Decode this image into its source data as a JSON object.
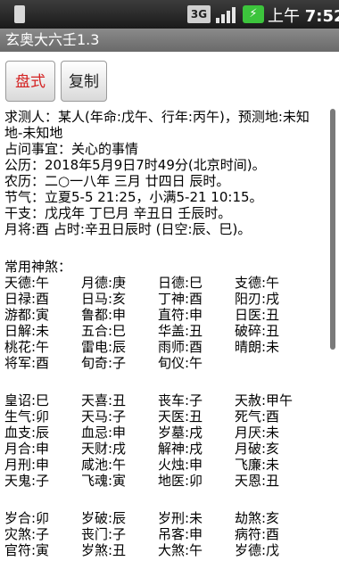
{
  "statusbar": {
    "time_prefix": "上午",
    "time": "7:52",
    "network": "3G",
    "battery_icon": "battery-charging-icon"
  },
  "app": {
    "title": "玄奥大六壬1.3"
  },
  "toolbar": {
    "pan_label": "盘式",
    "copy_label": "复制"
  },
  "info": {
    "line1": "求测人：某人(年命:戊午、行年:丙午)，预测地:未知",
    "line2": "地-未知地",
    "line3": "占问事宜：关心的事情",
    "line4": "公历：2018年5月9日7时49分(北京时间)。",
    "line5": "农历：二○一八年 三月 廿四日 辰时。",
    "line6": "节气：立夏5-5 21:25，小满5-21 10:15。",
    "line7": "干支：戊戌年  丁巳月  辛丑日  壬辰时。",
    "line8": "  月将:酉   占时:辛丑日辰时 (日空:辰、巳)。"
  },
  "gods": {
    "heading": "常用神煞：",
    "group1": [
      [
        "天德:午",
        "月德:庚",
        "日德:巳",
        "支德:午"
      ],
      [
        "日禄:酉",
        "日马:亥",
        "丁神:酉",
        "阳刃:戌"
      ],
      [
        "游都:寅",
        "鲁都:申",
        "直符:申",
        "日医:丑"
      ],
      [
        "日解:未",
        "五合:巳",
        "华盖:丑",
        "破碎:丑"
      ],
      [
        "桃花:午",
        "雷电:辰",
        "雨师:酉",
        "晴朗:未"
      ],
      [
        "将军:酉",
        "旬奇:子",
        "旬仪:午",
        ""
      ]
    ],
    "group2": [
      [
        "皇诏:巳",
        "天喜:丑",
        "丧车:子",
        "天赦:甲午"
      ],
      [
        "生气:卯",
        "天马:子",
        "天医:丑",
        "死气:酉"
      ],
      [
        "血支:辰",
        "血忌:申",
        "岁墓:戌",
        "月厌:未"
      ],
      [
        "月合:申",
        "天财:戌",
        "解神:戌",
        "月破:亥"
      ],
      [
        "月刑:申",
        "咸池:午",
        "火烛:申",
        "飞廉:未"
      ],
      [
        "天鬼:子",
        "飞魂:寅",
        "地医:卯",
        "天恩:丑"
      ]
    ],
    "group3": [
      [
        "岁合:卯",
        "岁破:辰",
        "岁刑:未",
        "劫煞:亥"
      ],
      [
        "灾煞:子",
        "丧门:子",
        "吊客:申",
        "病符:酉"
      ],
      [
        "官符:寅",
        "岁煞:丑",
        "大煞:午",
        "岁德:戊"
      ]
    ]
  }
}
